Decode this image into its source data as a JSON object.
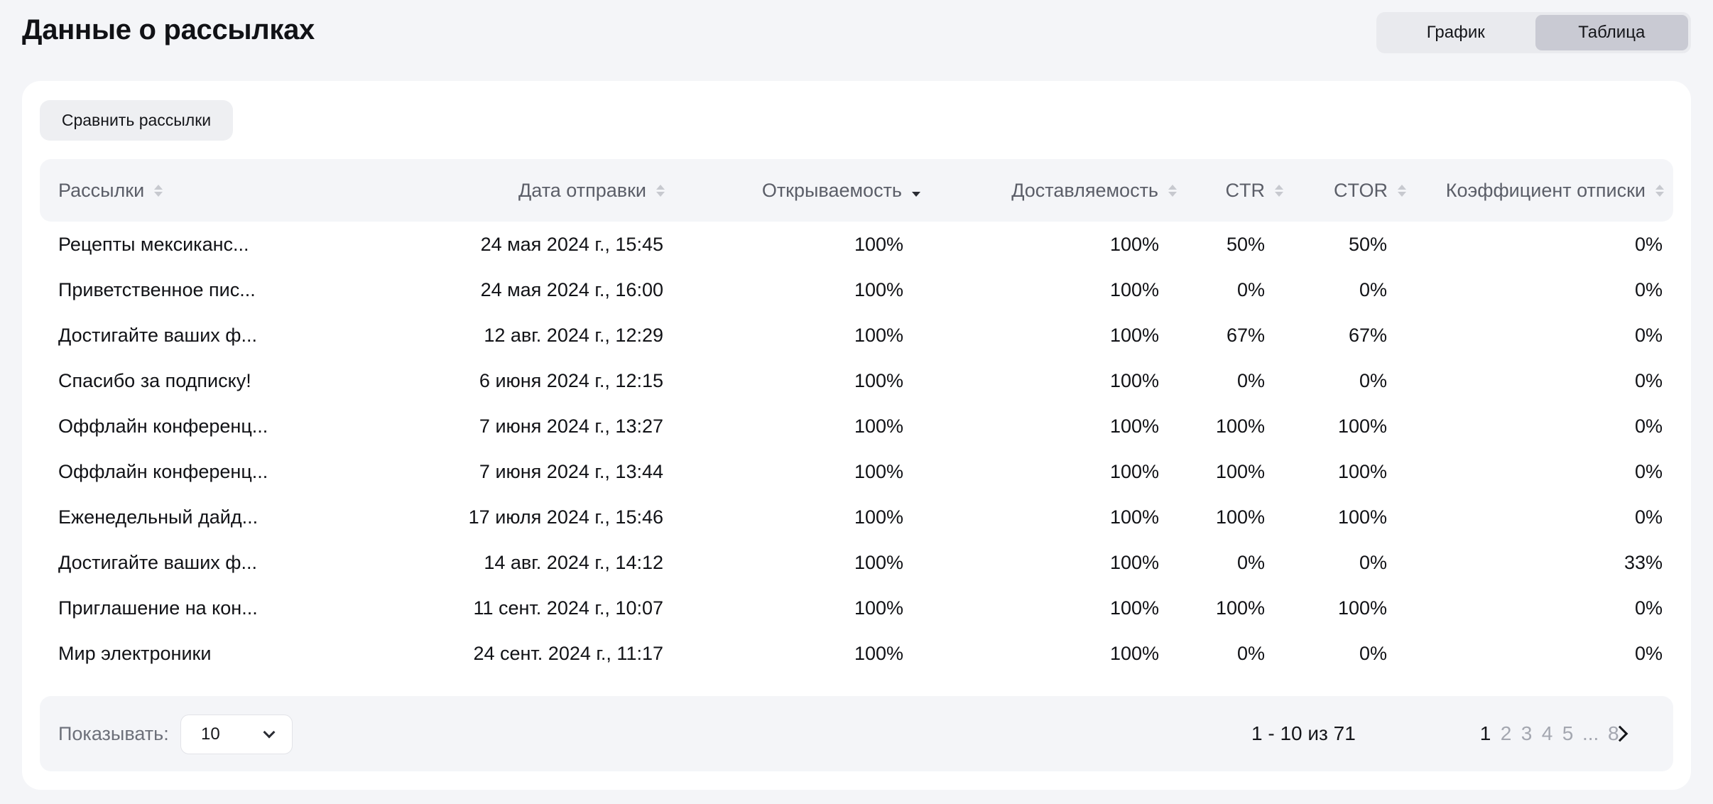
{
  "header": {
    "title": "Данные о рассылках",
    "view_tabs": [
      {
        "label": "График",
        "active": false
      },
      {
        "label": "Таблица",
        "active": true
      }
    ]
  },
  "toolbar": {
    "compare_label": "Сравнить рассылки"
  },
  "table": {
    "columns": [
      {
        "label": "Рассылки",
        "sort": "none"
      },
      {
        "label": "Дата отправки",
        "sort": "none"
      },
      {
        "label": "Открываемость",
        "sort": "desc"
      },
      {
        "label": "Доставляемость",
        "sort": "none"
      },
      {
        "label": "CTR",
        "sort": "none"
      },
      {
        "label": "CTOR",
        "sort": "none"
      },
      {
        "label": "Коэффициент отписки",
        "sort": "none"
      }
    ],
    "rows": [
      [
        "Рецепты мексиканс...",
        "24 мая 2024 г., 15:45",
        "100%",
        "100%",
        "50%",
        "50%",
        "0%"
      ],
      [
        "Приветственное пис...",
        "24 мая 2024 г., 16:00",
        "100%",
        "100%",
        "0%",
        "0%",
        "0%"
      ],
      [
        "Достигайте ваших ф...",
        "12 авг. 2024 г., 12:29",
        "100%",
        "100%",
        "67%",
        "67%",
        "0%"
      ],
      [
        "Спасибо за подписку!",
        "6 июня 2024 г., 12:15",
        "100%",
        "100%",
        "0%",
        "0%",
        "0%"
      ],
      [
        "Оффлайн конференц...",
        "7 июня 2024 г., 13:27",
        "100%",
        "100%",
        "100%",
        "100%",
        "0%"
      ],
      [
        "Оффлайн конференц...",
        "7 июня 2024 г., 13:44",
        "100%",
        "100%",
        "100%",
        "100%",
        "0%"
      ],
      [
        "Еженедельный дайд...",
        "17 июля 2024 г., 15:46",
        "100%",
        "100%",
        "100%",
        "100%",
        "0%"
      ],
      [
        "Достигайте ваших ф...",
        "14 авг. 2024 г., 14:12",
        "100%",
        "100%",
        "0%",
        "0%",
        "33%"
      ],
      [
        "Приглашение на кон...",
        "11 сент. 2024 г., 10:07",
        "100%",
        "100%",
        "100%",
        "100%",
        "0%"
      ],
      [
        "Мир электроники",
        "24 сент. 2024 г., 11:17",
        "100%",
        "100%",
        "0%",
        "0%",
        "0%"
      ]
    ]
  },
  "footer": {
    "show_label": "Показывать:",
    "page_size": "10",
    "range_text": "1 - 10 из 71",
    "pages": [
      "1",
      "2",
      "3",
      "4",
      "5"
    ],
    "ellipsis": "...",
    "last_page": "8",
    "current_page": "1",
    "next_icon": "chevron-right-icon",
    "dropdown_icon": "chevron-down-icon"
  }
}
